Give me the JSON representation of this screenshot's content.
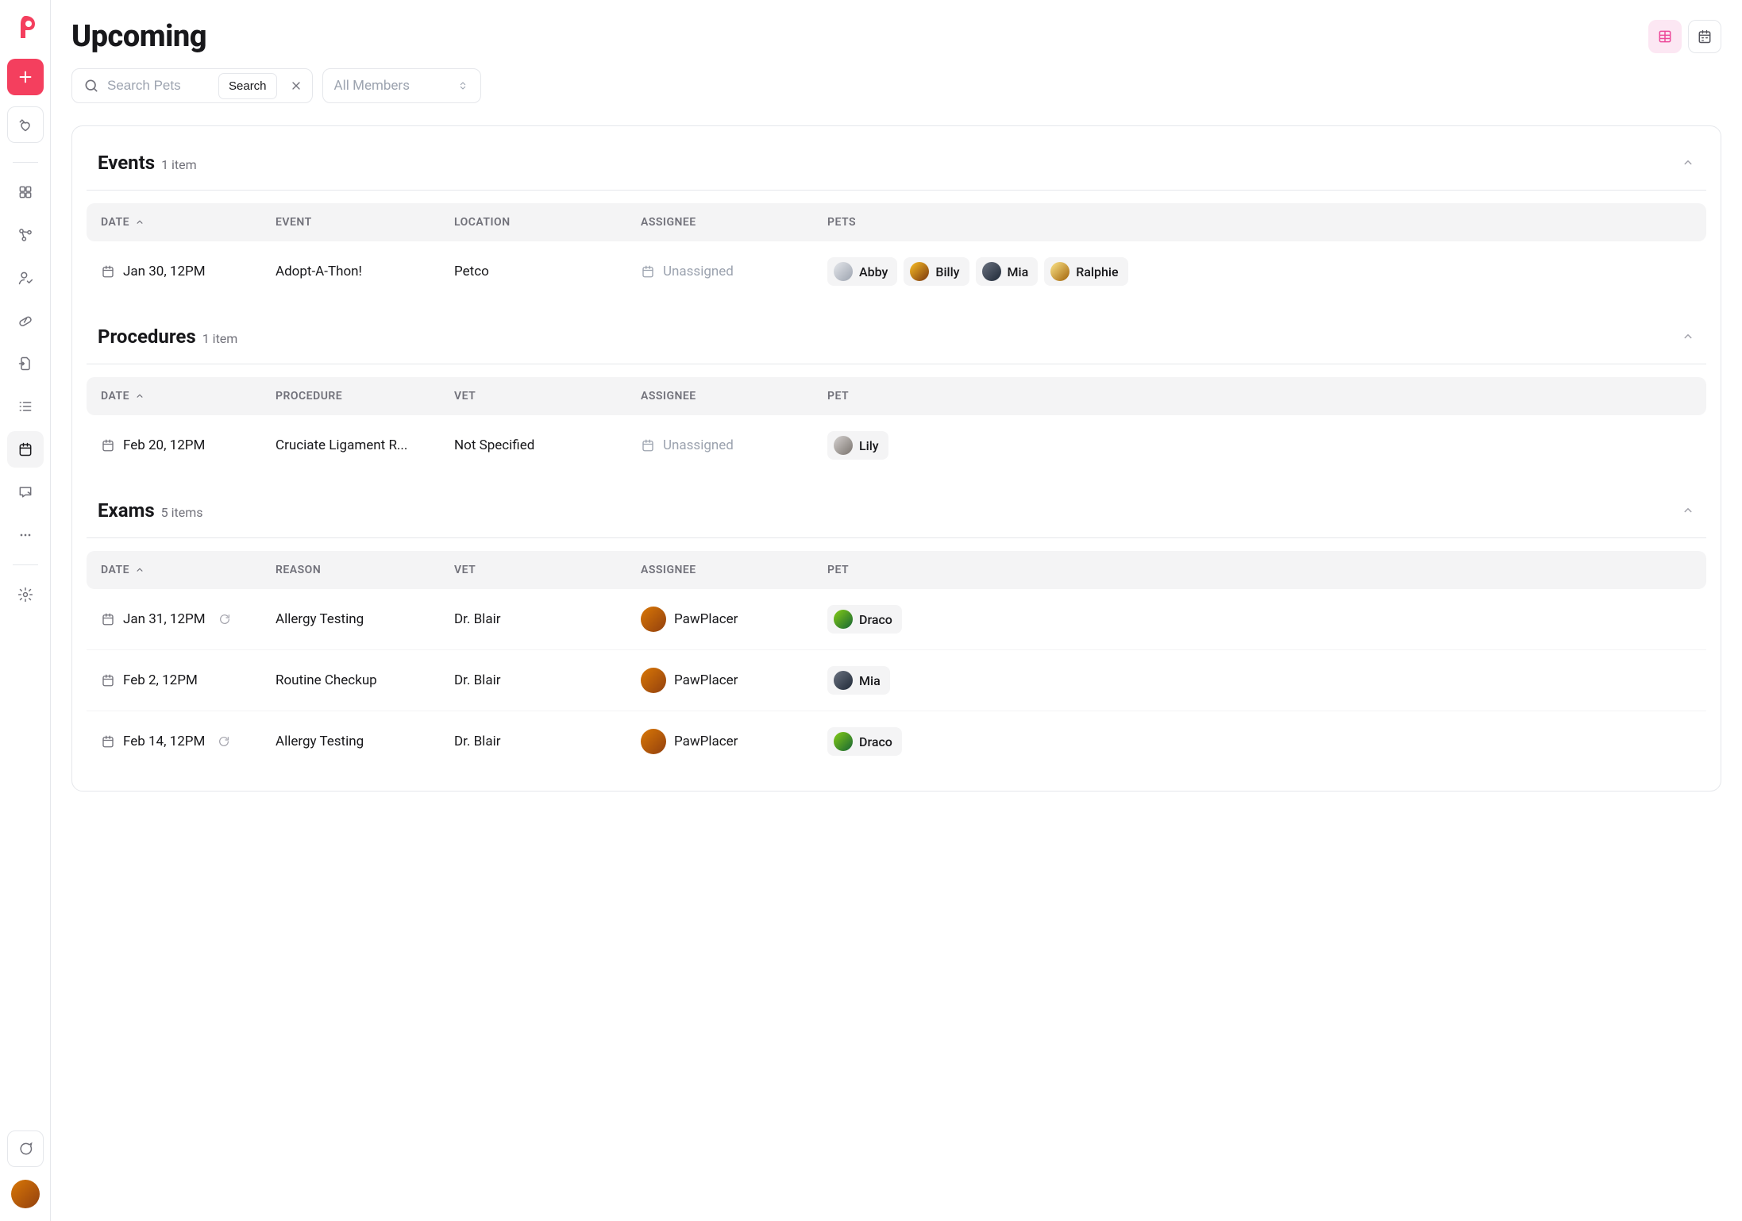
{
  "page_title": "Upcoming",
  "search": {
    "placeholder": "Search Pets",
    "submit_label": "Search"
  },
  "member_filter": {
    "placeholder": "All Members"
  },
  "columns": {
    "date": "DATE",
    "event": "EVENT",
    "location": "LOCATION",
    "assignee": "ASSIGNEE",
    "pets": "PETS",
    "pet": "PET",
    "procedure": "PROCEDURE",
    "vet": "VET",
    "reason": "REASON"
  },
  "unassigned_label": "Unassigned",
  "sections": {
    "events": {
      "title": "Events",
      "count_label": "1 item",
      "rows": [
        {
          "date": "Jan 30, 12PM",
          "event": "Adopt-A-Thon!",
          "location": "Petco",
          "assignee": null,
          "pets": [
            {
              "name": "Abby",
              "avatar_class": "av-a"
            },
            {
              "name": "Billy",
              "avatar_class": "av-b"
            },
            {
              "name": "Mia",
              "avatar_class": "av-c"
            },
            {
              "name": "Ralphie",
              "avatar_class": "av-d"
            }
          ]
        }
      ]
    },
    "procedures": {
      "title": "Procedures",
      "count_label": "1 item",
      "rows": [
        {
          "date": "Feb 20, 12PM",
          "procedure": "Cruciate Ligament R...",
          "vet": "Not Specified",
          "assignee": null,
          "pet": {
            "name": "Lily",
            "avatar_class": "av-e"
          }
        }
      ]
    },
    "exams": {
      "title": "Exams",
      "count_label": "5 items",
      "rows": [
        {
          "date": "Jan 31, 12PM",
          "recurring": true,
          "reason": "Allergy Testing",
          "vet": "Dr. Blair",
          "assignee": {
            "name": "PawPlacer",
            "avatar_class": "av-g"
          },
          "pet": {
            "name": "Draco",
            "avatar_class": "av-f"
          }
        },
        {
          "date": "Feb 2, 12PM",
          "recurring": false,
          "reason": "Routine Checkup",
          "vet": "Dr. Blair",
          "assignee": {
            "name": "PawPlacer",
            "avatar_class": "av-g"
          },
          "pet": {
            "name": "Mia",
            "avatar_class": "av-c"
          }
        },
        {
          "date": "Feb 14, 12PM",
          "recurring": true,
          "reason": "Allergy Testing",
          "vet": "Dr. Blair",
          "assignee": {
            "name": "PawPlacer",
            "avatar_class": "av-g"
          },
          "pet": {
            "name": "Draco",
            "avatar_class": "av-f"
          }
        }
      ]
    }
  }
}
